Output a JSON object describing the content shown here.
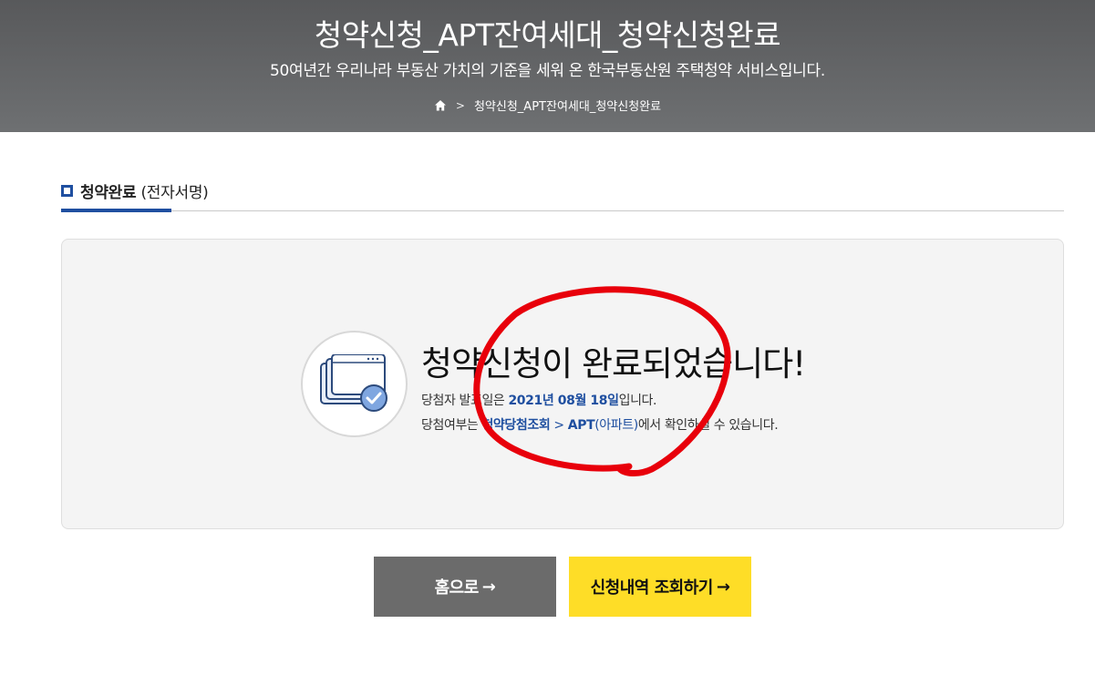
{
  "header": {
    "title": "청약신청_APT잔여세대_청약신청완료",
    "subtitle": "50여년간 우리나라 부동산 가치의 기준을 세워 온 한국부동산원 주택청약 서비스입니다.",
    "breadcrumb_current": "청약신청_APT잔여세대_청약신청완료",
    "home_icon": "home-icon",
    "separator": ">"
  },
  "section": {
    "title_main": "청약완료",
    "title_sub": " (전자서명)"
  },
  "result": {
    "icon": "document-check-icon",
    "message": "청약신청이 완료되었습니다!",
    "announce_prefix": "당첨자 발표일은 ",
    "announce_date": "2021년 08월 18일",
    "announce_suffix": "입니다.",
    "check_prefix": "당첨여부는 ",
    "check_menu": "청약당첨조회",
    "check_sep": " > ",
    "check_item": "APT",
    "check_item_paren": "(아파트)",
    "check_suffix": "에서 확인하실 수 있습니다."
  },
  "buttons": {
    "home_label": "홈으로",
    "history_label": "신청내역 조회하기",
    "arrow": "→"
  },
  "colors": {
    "accent_blue": "#1f4fa0",
    "yellow_button": "#fedd27",
    "gray_button": "#6b6b6b",
    "annotation_red": "#e8000b"
  }
}
